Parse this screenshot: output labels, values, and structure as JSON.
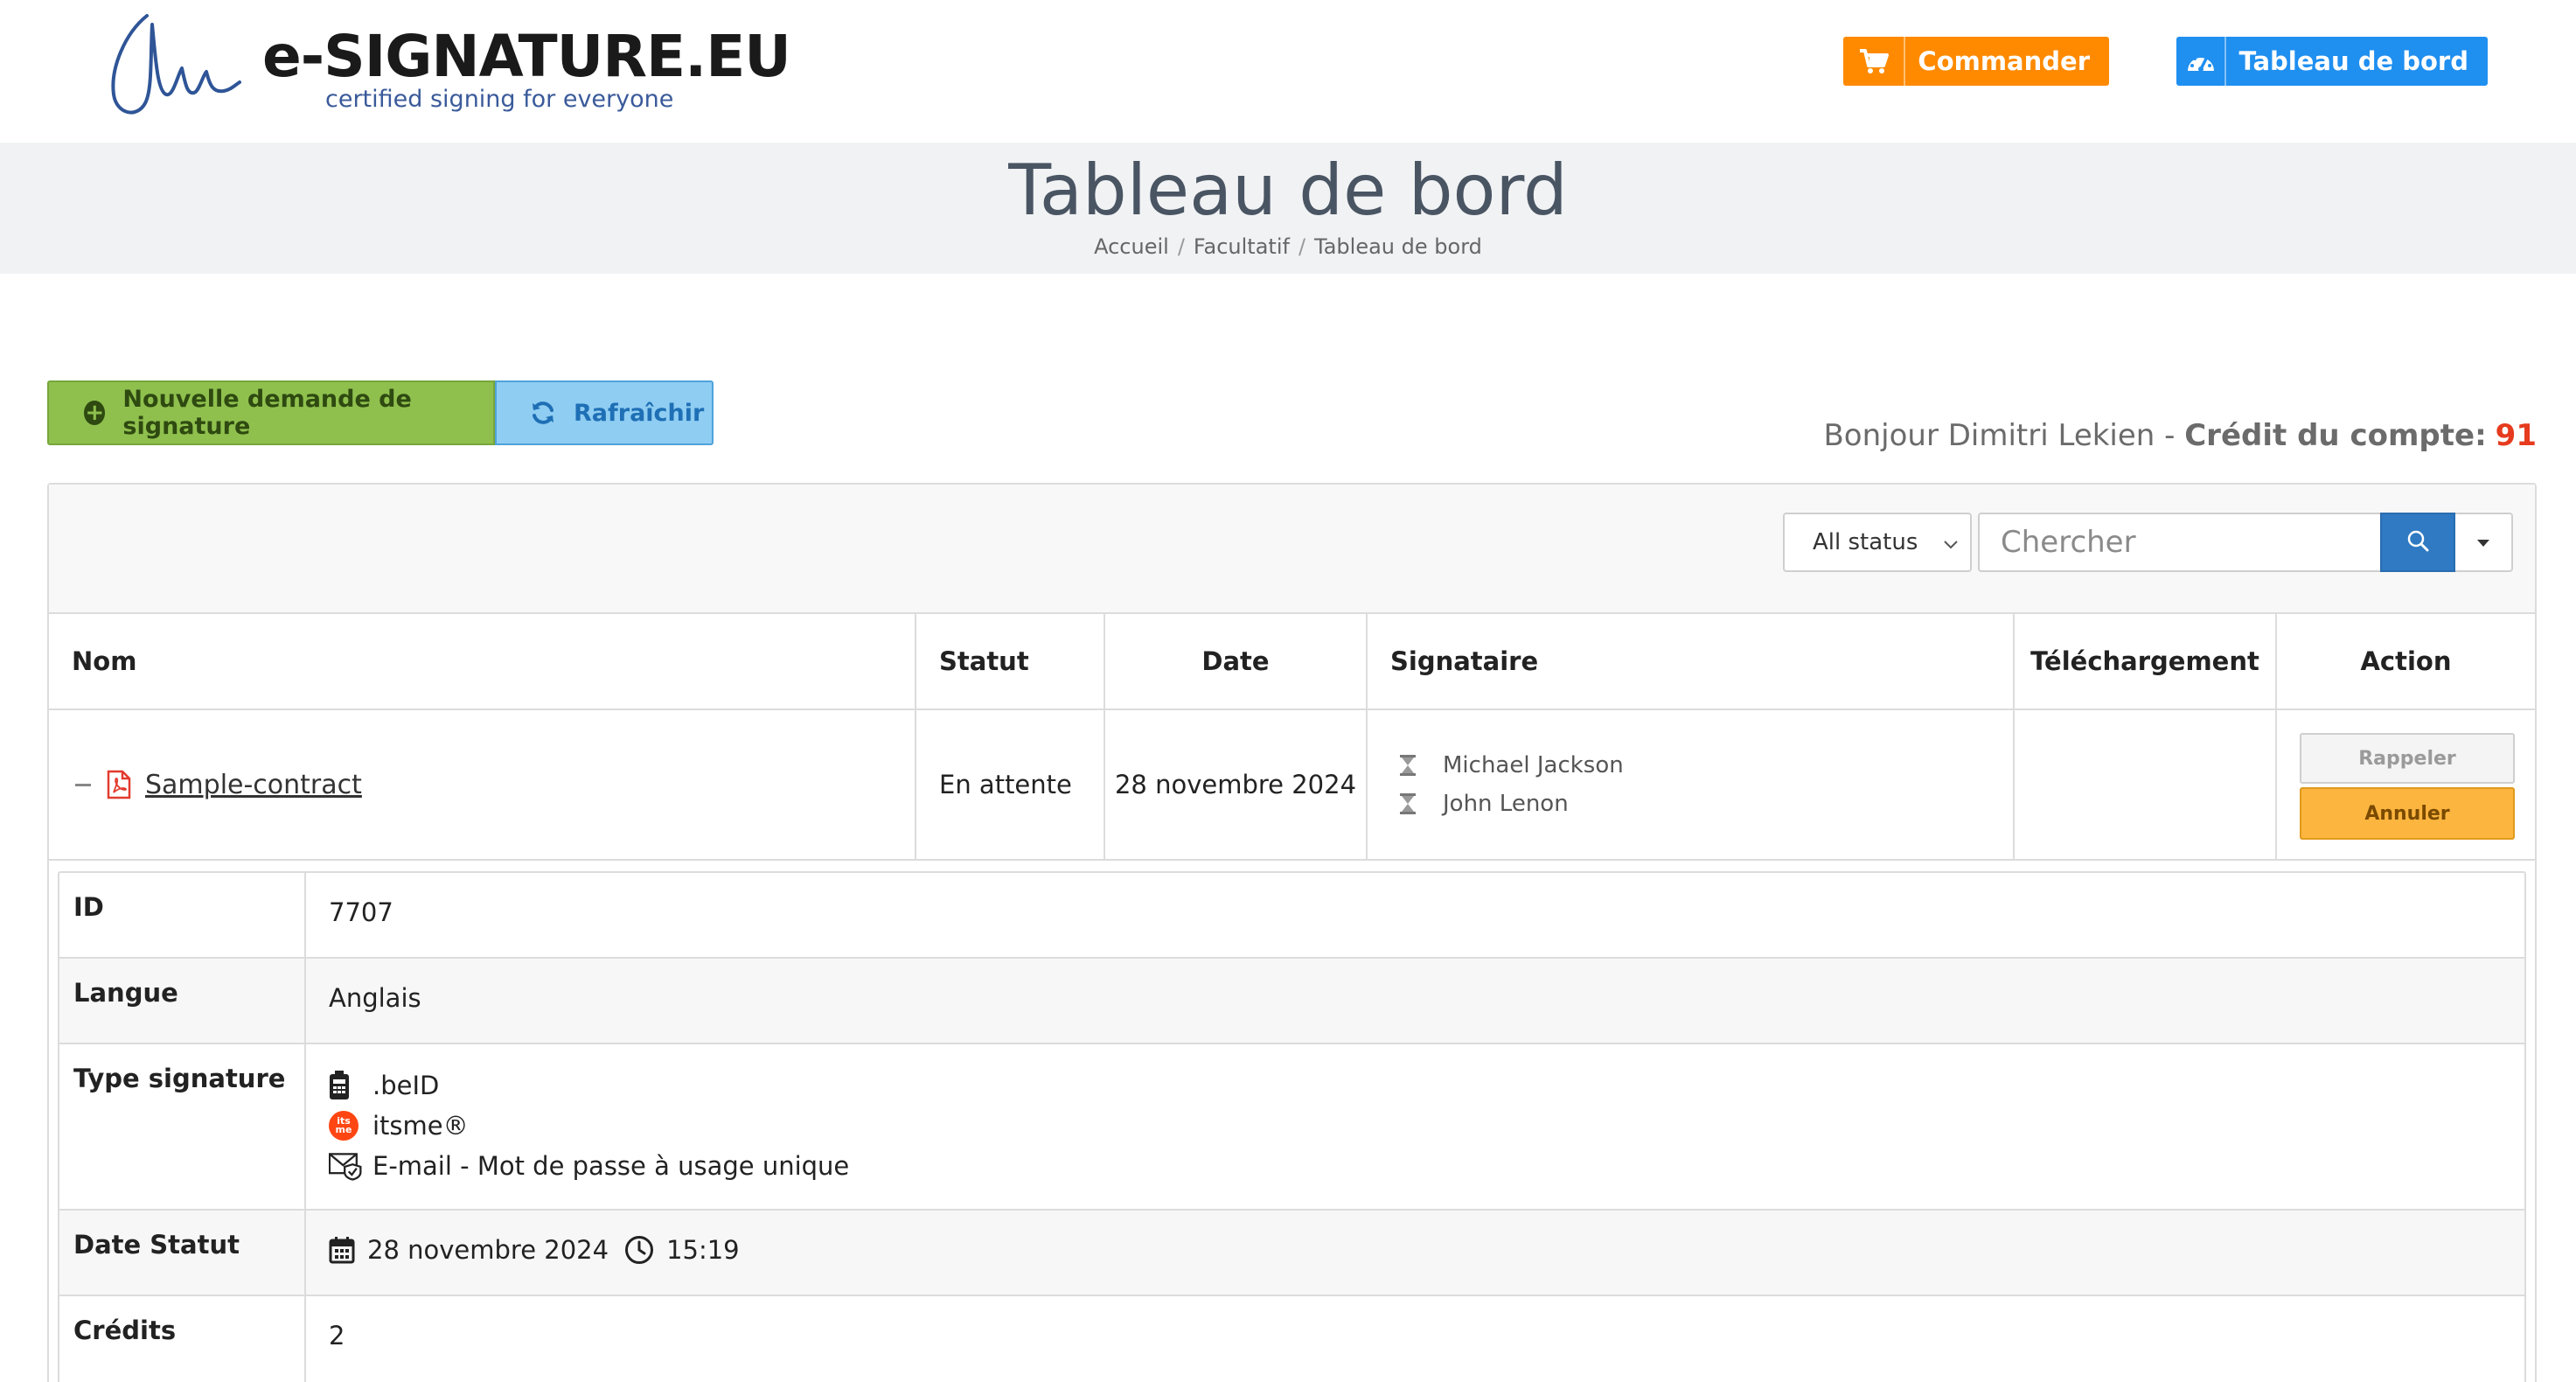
{
  "brand": {
    "name": "e-SIGNATURE.EU",
    "tagline": "certified signing for everyone"
  },
  "header": {
    "order_label": "Commander",
    "dashboard_label": "Tableau de bord",
    "order_color": "#ff8a00",
    "dashboard_color": "#1f8ff0"
  },
  "page": {
    "title": "Tableau de bord",
    "breadcrumb": [
      "Accueil",
      "Facultatif",
      "Tableau de bord"
    ]
  },
  "actions": {
    "new_request_label": "Nouvelle demande de signature",
    "refresh_label": "Rafraîchir"
  },
  "account": {
    "greeting": "Bonjour Dimitri Lekien - ",
    "credit_label": "Crédit du compte:",
    "credit_value": "91"
  },
  "filters": {
    "status_selected": "All status",
    "search_placeholder": "Chercher"
  },
  "table": {
    "headers": {
      "name": "Nom",
      "status": "Statut",
      "date": "Date",
      "signer": "Signataire",
      "download": "Téléchargement",
      "action": "Action"
    },
    "rows": [
      {
        "name": "Sample-contract",
        "status": "En attente",
        "date": "28 novembre 2024",
        "signers": [
          "Michael Jackson",
          "John Lenon"
        ],
        "remind_label": "Rappeler",
        "cancel_label": "Annuler"
      }
    ]
  },
  "details": {
    "id_label": "ID",
    "id_value": "7707",
    "language_label": "Langue",
    "language_value": "Anglais",
    "sigtype_label": "Type signature",
    "sigtypes": [
      ".beID",
      "itsme®",
      "E-mail - Mot de passe à usage unique"
    ],
    "itsme_badge": "its me",
    "date_status_label": "Date Statut",
    "date_status_date": "28 novembre 2024",
    "date_status_time": "15:19",
    "credits_label": "Crédits",
    "credits_value": "2"
  }
}
